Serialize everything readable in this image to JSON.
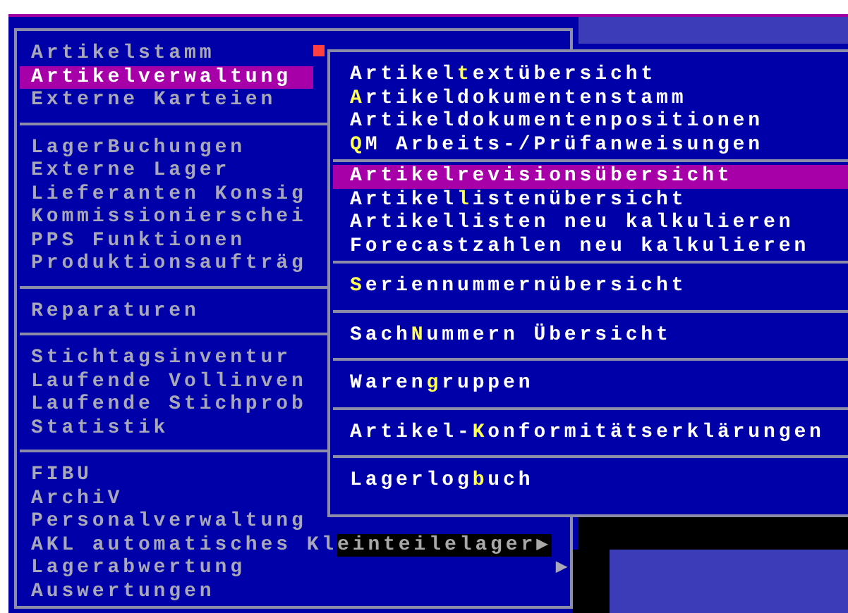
{
  "main_menu": {
    "groups": [
      {
        "items": [
          {
            "label": "Artikelstamm",
            "selected": false
          },
          {
            "label": "Artikelverwaltung",
            "selected": true
          },
          {
            "label": "Externe Karteien",
            "selected": false
          }
        ]
      },
      {
        "items": [
          {
            "label": "LagerBuchungen",
            "selected": false
          },
          {
            "label": "Externe Lager",
            "selected": false
          },
          {
            "label": "Lieferanten Konsig",
            "selected": false
          },
          {
            "label": "Kommissionierschei",
            "selected": false
          },
          {
            "label": "PPS Funktionen",
            "selected": false
          },
          {
            "label": "Produktionsaufträg",
            "selected": false
          }
        ]
      },
      {
        "items": [
          {
            "label": "Reparaturen",
            "selected": false
          }
        ]
      },
      {
        "items": [
          {
            "label": "Stichtagsinventur",
            "selected": false
          },
          {
            "label": "Laufende Vollinven",
            "selected": false
          },
          {
            "label": "Laufende Stichprob",
            "selected": false
          },
          {
            "label": "Statistik",
            "selected": false
          }
        ]
      },
      {
        "items": [
          {
            "label": "FIBU",
            "selected": false
          },
          {
            "label": "ArchiV",
            "selected": false
          },
          {
            "label": "Personalverwaltung",
            "selected": false
          },
          {
            "label": "AKL automatisches Kl",
            "shadowed_text": "einteilelager",
            "arrow": "▶",
            "selected": false
          },
          {
            "label": "Lagerabwertung",
            "arrow": "▶",
            "selected": false
          },
          {
            "label": "Auswertungen",
            "selected": false
          }
        ]
      }
    ]
  },
  "submenu": {
    "groups": [
      {
        "items": [
          {
            "pre": "Artikel",
            "key": "t",
            "post": "extübersicht",
            "selected": false
          },
          {
            "key": "A",
            "post": "rtikeldokumentenstamm",
            "selected": false
          },
          {
            "pre": "Artikeldokumentenpositionen",
            "selected": false
          },
          {
            "key": "Q",
            "post": "M Arbeits-/Prüfanweisungen",
            "selected": false
          }
        ]
      },
      {
        "items": [
          {
            "pre": "Artikelrevisionsübersicht",
            "selected": true
          },
          {
            "pre": "Artikel",
            "key": "l",
            "post": "istenübersicht",
            "selected": false
          },
          {
            "pre": "Artikellisten neu kalkulieren",
            "selected": false
          },
          {
            "pre": "Forecastzahlen neu kalkulieren",
            "selected": false
          }
        ]
      },
      {
        "items": [
          {
            "key": "S",
            "post": "eriennummernübersicht",
            "selected": false
          }
        ]
      },
      {
        "items": [
          {
            "pre": "Sach",
            "key": "N",
            "post": "ummern Übersicht",
            "selected": false
          }
        ]
      },
      {
        "items": [
          {
            "pre": "Waren",
            "key": "g",
            "post": "ruppen",
            "selected": false
          }
        ]
      },
      {
        "items": [
          {
            "pre": "Artikel-",
            "key": "K",
            "post": "onformitätserklärungen",
            "selected": false
          }
        ]
      },
      {
        "items": [
          {
            "pre": "Lagerlog",
            "key": "b",
            "post": "uch",
            "selected": false
          }
        ]
      }
    ]
  }
}
